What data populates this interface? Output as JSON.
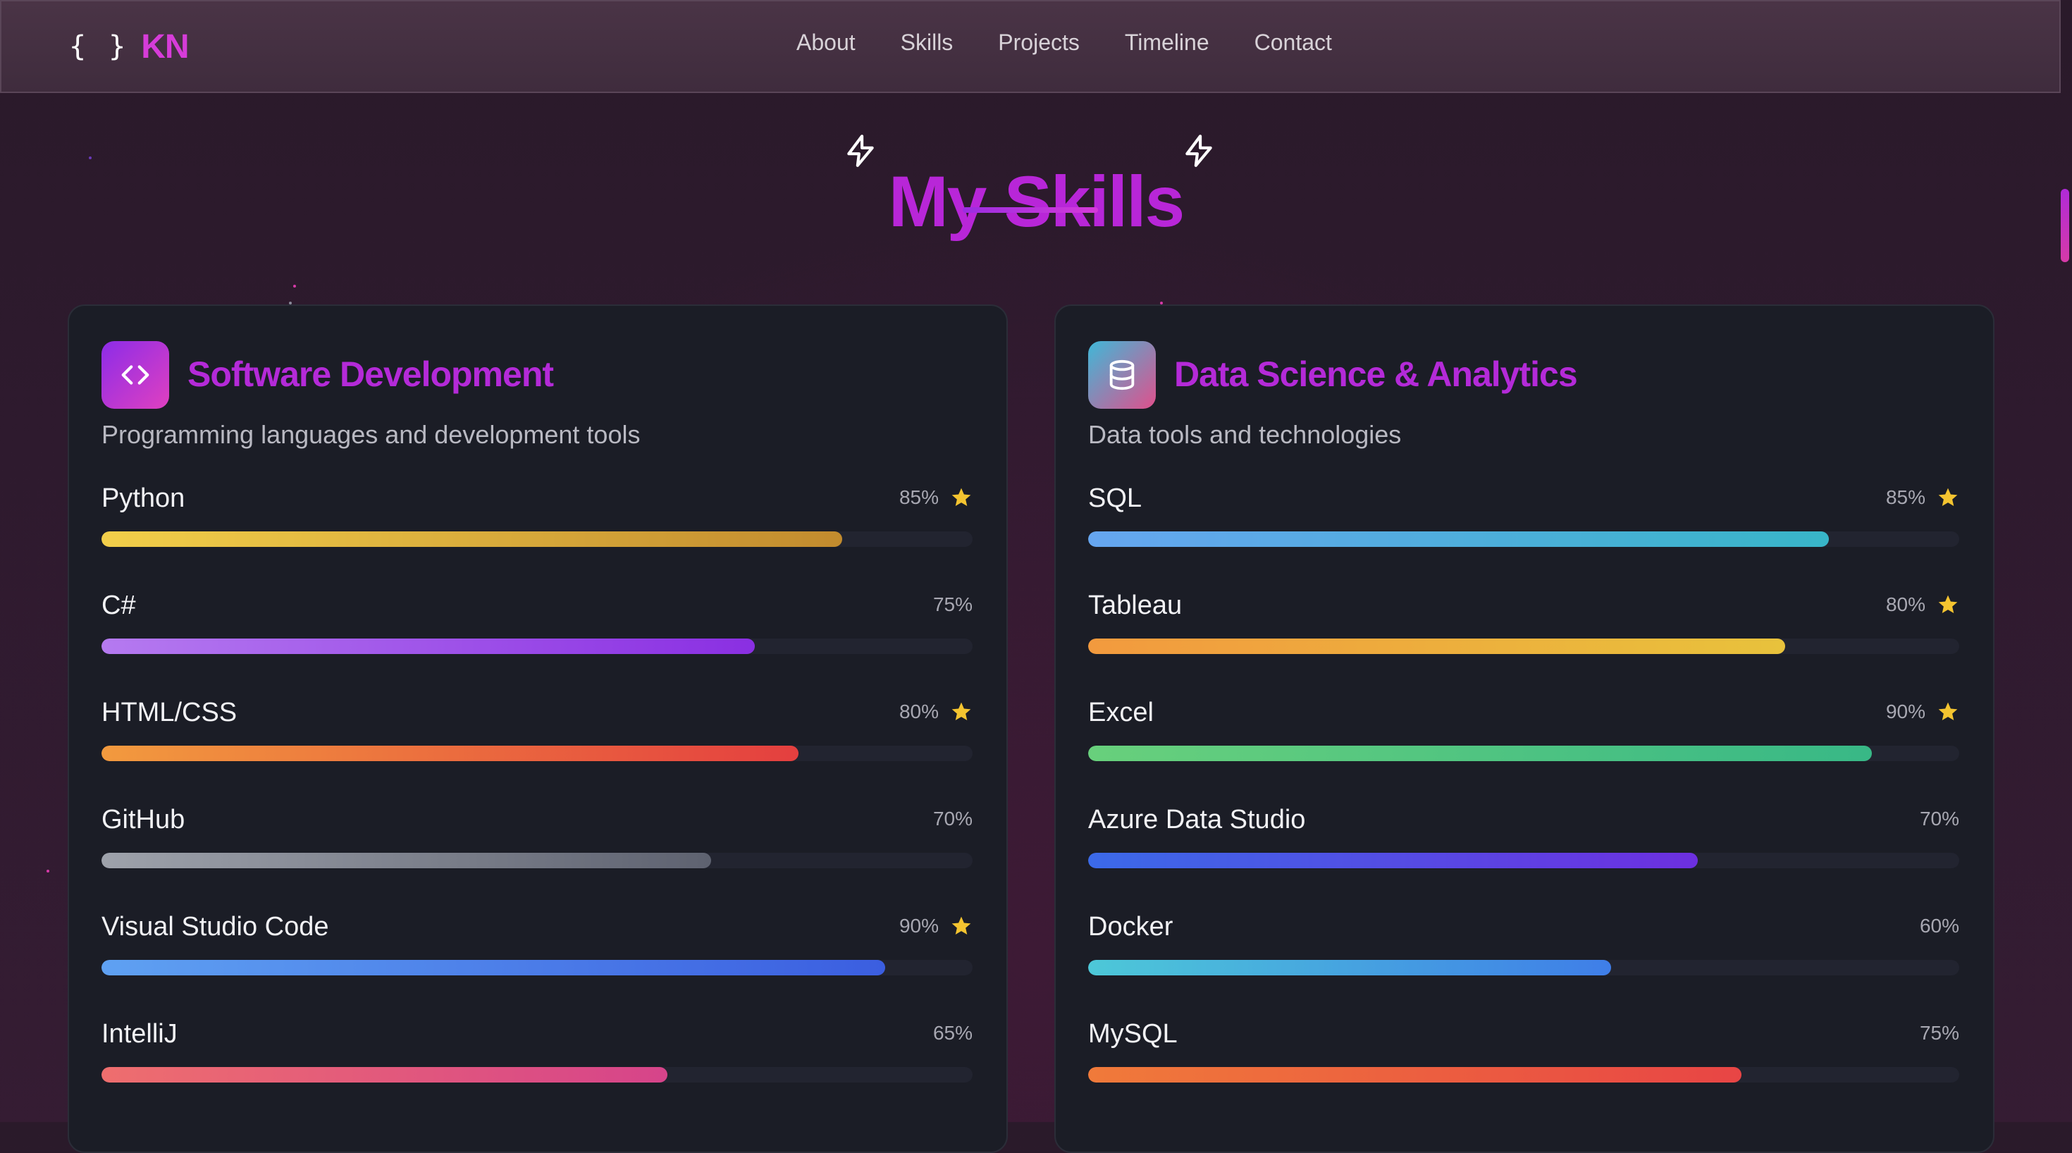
{
  "nav": {
    "logo_brace": "{ }",
    "logo_text": "KN",
    "links": [
      "About",
      "Skills",
      "Projects",
      "Timeline",
      "Contact"
    ]
  },
  "page": {
    "title": "My Skills"
  },
  "cards": [
    {
      "title": "Software Development",
      "subtitle": "Programming languages and development tools",
      "icon": "code-icon",
      "skills": [
        {
          "name": "Python",
          "percent_label": "85%",
          "value": 85,
          "starred": true,
          "gradient": [
            "#f2cf4a",
            "#c28b2e"
          ]
        },
        {
          "name": "C#",
          "percent_label": "75%",
          "value": 75,
          "starred": false,
          "gradient": [
            "#b57af0",
            "#8a2fe2"
          ]
        },
        {
          "name": "HTML/CSS",
          "percent_label": "80%",
          "value": 80,
          "starred": true,
          "gradient": [
            "#f29a3e",
            "#e43f3f"
          ]
        },
        {
          "name": "GitHub",
          "percent_label": "70%",
          "value": 70,
          "starred": false,
          "gradient": [
            "#9ea2ab",
            "#5e6270"
          ]
        },
        {
          "name": "Visual Studio Code",
          "percent_label": "90%",
          "value": 90,
          "starred": true,
          "gradient": [
            "#5fa1f2",
            "#3b5ee0"
          ]
        },
        {
          "name": "IntelliJ",
          "percent_label": "65%",
          "value": 65,
          "starred": false,
          "gradient": [
            "#ee6e6e",
            "#d6448a"
          ]
        }
      ]
    },
    {
      "title": "Data Science & Analytics",
      "subtitle": "Data tools and technologies",
      "icon": "database-icon",
      "skills": [
        {
          "name": "SQL",
          "percent_label": "85%",
          "value": 85,
          "starred": true,
          "gradient": [
            "#66a6f0",
            "#38b5c8"
          ]
        },
        {
          "name": "Tableau",
          "percent_label": "80%",
          "value": 80,
          "starred": true,
          "gradient": [
            "#f29a3e",
            "#e8c23c"
          ]
        },
        {
          "name": "Excel",
          "percent_label": "90%",
          "value": 90,
          "starred": true,
          "gradient": [
            "#68d07c",
            "#38b886"
          ]
        },
        {
          "name": "Azure Data Studio",
          "percent_label": "70%",
          "value": 70,
          "starred": false,
          "gradient": [
            "#3b6ae8",
            "#6d2fe0"
          ]
        },
        {
          "name": "Docker",
          "percent_label": "60%",
          "value": 60,
          "starred": false,
          "gradient": [
            "#4dc8d8",
            "#3f7ee8"
          ]
        },
        {
          "name": "MySQL",
          "percent_label": "75%",
          "value": 75,
          "starred": false,
          "gradient": [
            "#f07a3a",
            "#e84545"
          ]
        }
      ]
    }
  ],
  "colors": {
    "accent": "#b826d8",
    "star": "#f4c430"
  }
}
